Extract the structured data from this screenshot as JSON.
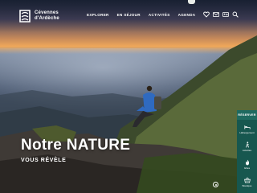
{
  "brand": {
    "name_line1": "Cévennes",
    "name_line2": "d'Ardèche"
  },
  "nav": {
    "items": [
      "EXPLORER",
      "EN SÉJOUR",
      "ACTIVITÉS",
      "AGENDA"
    ]
  },
  "header_icons": [
    "heart-icon",
    "mail-icon",
    "contact-card-icon",
    "search-icon"
  ],
  "hero": {
    "title": "Notre NATURE",
    "subtitle": "VOUS RÉVÈLE"
  },
  "side_panel": {
    "header": "RÉSERVER",
    "items": [
      {
        "label": "Hébergement",
        "icon": "bed-icon"
      },
      {
        "label": "Activités",
        "icon": "hiker-icon"
      },
      {
        "label": "Gîtes",
        "icon": "flame-icon"
      },
      {
        "label": "Boutique",
        "icon": "basket-icon"
      }
    ]
  },
  "colors": {
    "side_panel": "#17574f",
    "text": "#ffffff"
  }
}
